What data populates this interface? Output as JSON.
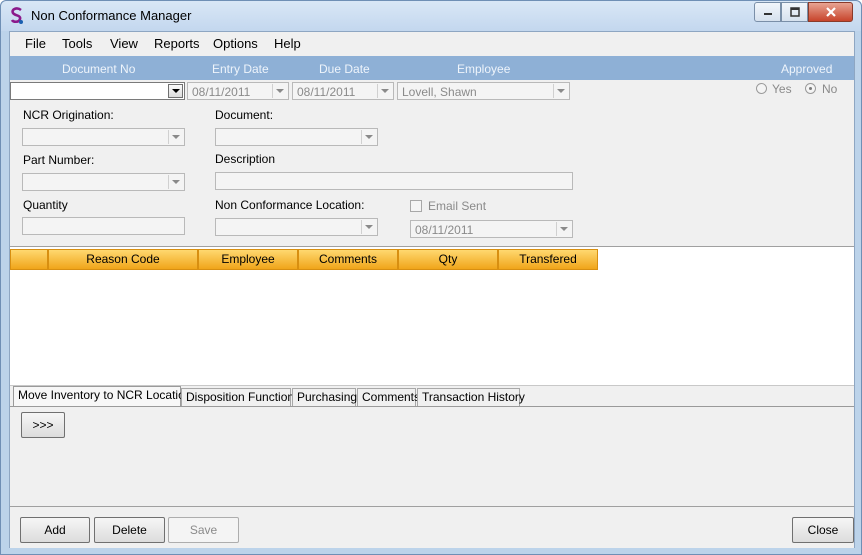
{
  "window": {
    "title": "Non Conformance Manager",
    "app_icon": "app-logo-icon"
  },
  "menu": [
    "File",
    "Tools",
    "View",
    "Reports",
    "Options",
    "Help"
  ],
  "header": {
    "document_no": "Document No",
    "entry_date": "Entry Date",
    "due_date": "Due Date",
    "employee": "Employee",
    "approved": "Approved"
  },
  "record": {
    "document_no_value": "",
    "entry_date_value": "08/11/2011",
    "due_date_value": "08/11/2011",
    "employee_value": "Lovell, Shawn",
    "approved_yes": "Yes",
    "approved_no": "No",
    "approved_selected": "No"
  },
  "form": {
    "ncr_origination_label": "NCR Origination:",
    "document_label": "Document:",
    "part_number_label": "Part Number:",
    "description_label": "Description",
    "quantity_label": "Quantity",
    "location_label": "Non Conformance Location:",
    "email_sent_label": "Email Sent",
    "email_date_value": "08/11/2011"
  },
  "grid": {
    "columns": [
      "",
      "Reason Code",
      "Employee",
      "Comments",
      "Qty",
      "Transfered"
    ],
    "header_color": "#f5b52e"
  },
  "tabs": [
    "Move Inventory to NCR Location",
    "Disposition Functions",
    "Purchasing",
    "Comments",
    "Transaction History"
  ],
  "active_tab": "Move Inventory to NCR Location",
  "tab_panel": {
    "move_button": ">>>"
  },
  "footer": {
    "add": "Add",
    "delete": "Delete",
    "save": "Save",
    "close": "Close"
  },
  "colors": {
    "title_bar": "#c3d7ee",
    "header_band": "#8eb0d6",
    "close_button": "#c7442b"
  }
}
